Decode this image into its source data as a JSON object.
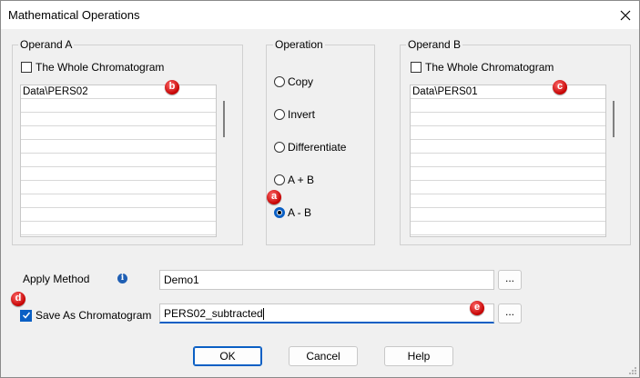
{
  "window": {
    "title": "Mathematical Operations",
    "close_label": "✕"
  },
  "operand_a": {
    "legend": "Operand A",
    "whole_chromatogram_label": "The Whole Chromatogram",
    "rows": [
      "Data\\PERS02",
      "",
      "",
      "",
      "",
      "",
      "",
      "",
      "",
      "",
      ""
    ]
  },
  "operation": {
    "legend": "Operation",
    "options": [
      "Copy",
      "Invert",
      "Differentiate",
      "A + B",
      "A - B"
    ],
    "selected": "A - B"
  },
  "operand_b": {
    "legend": "Operand B",
    "whole_chromatogram_label": "The Whole Chromatogram",
    "rows": [
      "Data\\PERS01",
      "",
      "",
      "",
      "",
      "",
      "",
      "",
      "",
      "",
      ""
    ]
  },
  "apply_method": {
    "label": "Apply Method",
    "info_icon": "i",
    "value": "Demo1",
    "browse_label": "..."
  },
  "save_as": {
    "label": "Save As Chromatogram",
    "checked": true,
    "value": "PERS02_subtracted",
    "browse_label": "..."
  },
  "buttons": {
    "ok": "OK",
    "cancel": "Cancel",
    "help": "Help"
  },
  "callouts": {
    "a": "a",
    "b": "b",
    "c": "c",
    "d": "d",
    "e": "e"
  }
}
